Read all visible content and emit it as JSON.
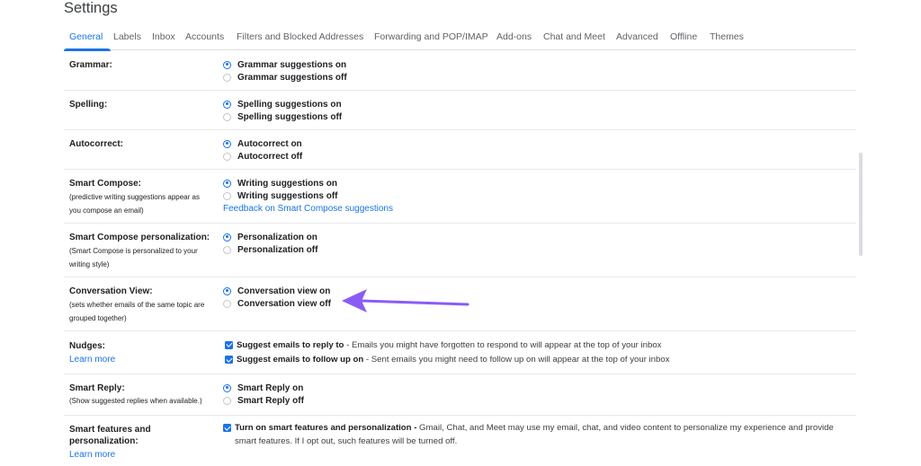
{
  "page": {
    "title": "Settings"
  },
  "tabs": [
    {
      "label": "General",
      "active": true
    },
    {
      "label": "Labels"
    },
    {
      "label": "Inbox"
    },
    {
      "label": "Accounts"
    },
    {
      "label": "Filters and Blocked Addresses"
    },
    {
      "label": "Forwarding and POP/IMAP"
    },
    {
      "label": "Add-ons"
    },
    {
      "label": "Chat and Meet"
    },
    {
      "label": "Advanced"
    },
    {
      "label": "Offline"
    },
    {
      "label": "Themes"
    }
  ],
  "settings": {
    "grammar": {
      "label": "Grammar:",
      "on": "Grammar suggestions on",
      "off": "Grammar suggestions off",
      "selected": "on"
    },
    "spelling": {
      "label": "Spelling:",
      "on": "Spelling suggestions on",
      "off": "Spelling suggestions off",
      "selected": "on"
    },
    "autocorrect": {
      "label": "Autocorrect:",
      "on": "Autocorrect on",
      "off": "Autocorrect off",
      "selected": "on"
    },
    "smart_compose": {
      "label": "Smart Compose:",
      "desc1": "(predictive writing suggestions appear as",
      "desc2": "you compose an email)",
      "on": "Writing suggestions on",
      "off": "Writing suggestions off",
      "feedback": "Feedback on Smart Compose suggestions",
      "selected": "on"
    },
    "personalization": {
      "label": "Smart Compose personalization:",
      "desc1": "(Smart Compose is personalized to your",
      "desc2": "writing style)",
      "on": "Personalization on",
      "off": "Personalization off",
      "selected": "on"
    },
    "conversation_view": {
      "label": "Conversation View:",
      "desc1": "(sets whether emails of the same topic are",
      "desc2": "grouped together)",
      "on": "Conversation view on",
      "off": "Conversation view off",
      "selected": "on"
    },
    "nudges": {
      "label": "Nudges:",
      "learn_more": "Learn more",
      "opt1_bold": "Suggest emails to reply to",
      "opt1_rest": " - Emails you might have forgotten to respond to will appear at the top of your inbox",
      "opt2_bold": "Suggest emails to follow up on",
      "opt2_rest": " - Sent emails you might need to follow up on will appear at the top of your inbox",
      "opt1_checked": true,
      "opt2_checked": true
    },
    "smart_reply": {
      "label": "Smart Reply:",
      "desc": "(Show suggested replies when available.)",
      "on": "Smart Reply on",
      "off": "Smart Reply off",
      "selected": "on"
    },
    "smart_features": {
      "label1": "Smart features and",
      "label2": "personalization:",
      "learn_more": "Learn more",
      "opt_bold": "Turn on smart features and personalization -",
      "opt_rest": " Gmail, Chat, and Meet may use my email, chat, and video content to personalize my experience and provide smart features. If I opt out, such features will be turned off.",
      "checked": true
    }
  },
  "colors": {
    "accent": "#1a73e8",
    "annotation_arrow": "#8a5cf6"
  },
  "icons": {
    "annotation": "arrow-left-icon"
  }
}
